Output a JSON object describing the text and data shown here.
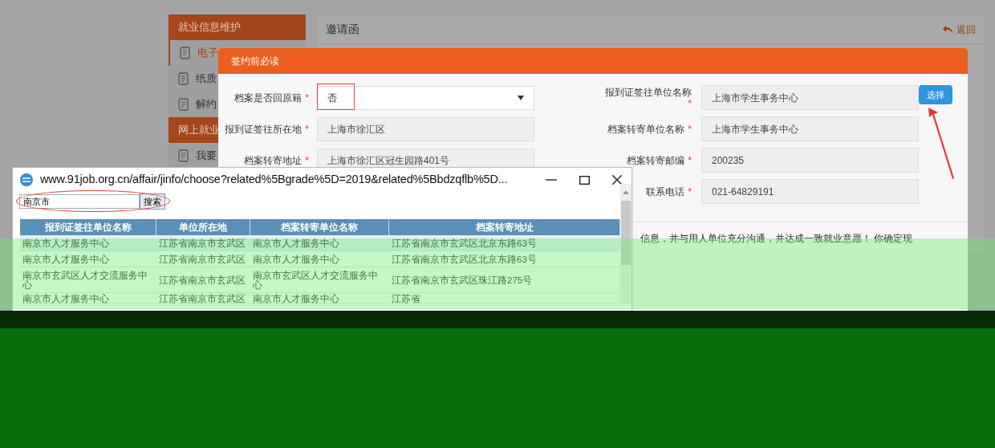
{
  "sidebar": {
    "sections": [
      {
        "title": "就业信息维护",
        "items": [
          {
            "label": "电子",
            "selected": true
          },
          {
            "label": "纸质",
            "selected": false
          },
          {
            "label": "解约",
            "selected": false
          }
        ]
      },
      {
        "title": "网上就业",
        "items": [
          {
            "label": "我要",
            "selected": false
          }
        ]
      }
    ]
  },
  "main": {
    "title": "邀请函",
    "back": "返回"
  },
  "modal": {
    "title": "签约前必读",
    "left_fields": [
      {
        "label": "档案是否回原籍",
        "required_mark": "*",
        "kind": "select",
        "value": "否"
      },
      {
        "label": "报到证签往所在地",
        "required_mark": "*",
        "kind": "text",
        "value": "上海市徐汇区"
      },
      {
        "label": "档案转寄地址",
        "required_mark": "*",
        "kind": "text",
        "value": "上海市徐汇区冠生园路401号"
      }
    ],
    "right_fields": [
      {
        "label": "报到证签往单位名称",
        "required_mark": "*",
        "value": "上海市学生事务中心",
        "button": "选择"
      },
      {
        "label": "档案转寄单位名称",
        "required_mark": "*",
        "value": "上海市学生事务中心"
      },
      {
        "label": "档案转寄邮编",
        "required_mark": "*",
        "value": "200235"
      },
      {
        "label": "联系电话",
        "required_mark": "*",
        "value": "021-64829191"
      }
    ],
    "notice": "信息，并与用人单位充分沟通，并达成一致就业意愿！ 你确定现"
  },
  "popup": {
    "url": "www.91job.org.cn/affair/jinfo/choose?related%5Bgrade%5D=2019&related%5Bbdzqflb%5D...",
    "search": {
      "value": "南京市",
      "button": "搜索"
    },
    "table": {
      "columns": [
        "报到证签往单位名称",
        "单位所在地",
        "档案转寄单位名称",
        "档案转寄地址"
      ],
      "rows": [
        [
          "南京市人才服务中心",
          "江苏省南京市玄武区",
          "南京市人才服务中心",
          "江苏省南京市玄武区北京东路63号"
        ],
        [
          "南京市人才服务中心",
          "江苏省南京市玄武区",
          "南京市人才服务中心",
          "江苏省南京市玄武区北京东路63号"
        ],
        [
          "南京市玄武区人才交流服务中心",
          "江苏省南京市玄武区",
          "南京市玄武区人才交流服务中心",
          "江苏省南京市玄武区珠江路275号"
        ],
        [
          "南京市人才服务中心",
          "江苏省南京市玄武区",
          "南京市人才服务中心",
          "江苏省"
        ]
      ]
    }
  }
}
